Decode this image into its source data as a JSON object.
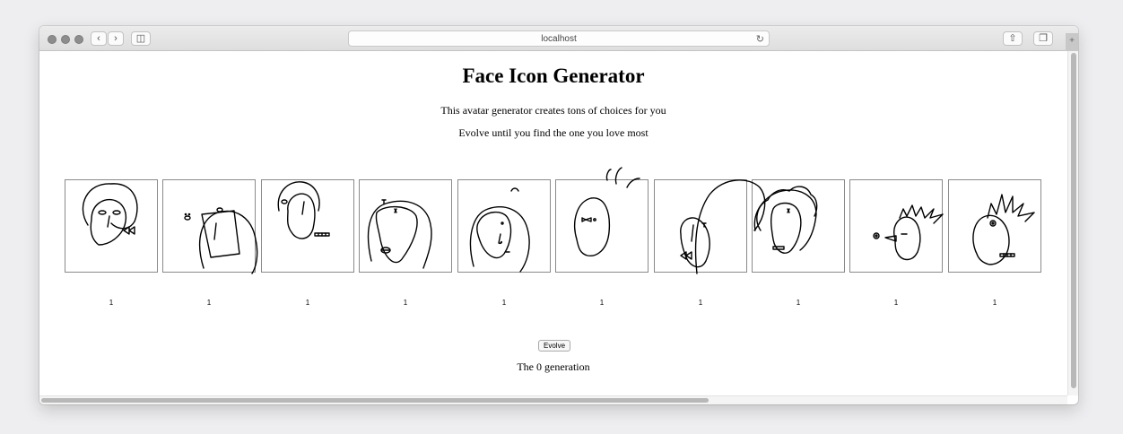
{
  "browser": {
    "url": "localhost"
  },
  "page": {
    "title": "Face Icon Generator",
    "subtitle_1": "This avatar generator creates tons of choices for you",
    "subtitle_2": "Evolve until you find the one you love most",
    "evolve_label": "Evolve",
    "generation_text": "The 0 generation"
  },
  "faces": [
    {
      "score": "1"
    },
    {
      "score": "1"
    },
    {
      "score": "1"
    },
    {
      "score": "1"
    },
    {
      "score": "1"
    },
    {
      "score": "1"
    },
    {
      "score": "1"
    },
    {
      "score": "1"
    },
    {
      "score": "1"
    },
    {
      "score": "1"
    }
  ],
  "icons": [
    "back-icon",
    "forward-icon",
    "sidebar-icon",
    "reload-icon",
    "share-icon",
    "tabs-icon"
  ]
}
